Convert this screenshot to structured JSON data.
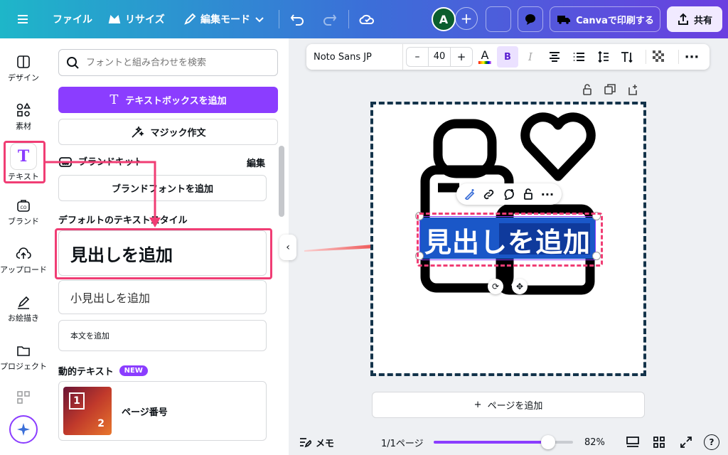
{
  "topbar": {
    "menu_icon": "hamburger-icon",
    "file_label": "ファイル",
    "resize_label": "リサイズ",
    "edit_mode_label": "編集モード",
    "avatar_initial": "A",
    "print_label": "Canvaで印刷する",
    "share_label": "共有"
  },
  "rail": [
    {
      "label": "デザイン",
      "icon": "layout-icon"
    },
    {
      "label": "素材",
      "icon": "shapes-icon"
    },
    {
      "label": "テキスト",
      "icon": "text-icon"
    },
    {
      "label": "ブランド",
      "icon": "brand-icon"
    },
    {
      "label": "アップロード",
      "icon": "upload-icon"
    },
    {
      "label": "お絵描き",
      "icon": "draw-icon"
    },
    {
      "label": "プロジェクト",
      "icon": "folder-icon"
    }
  ],
  "panel": {
    "search_placeholder": "フォントと組み合わせを検索",
    "add_textbox": "テキストボックスを追加",
    "magic_write": "マジック作文",
    "brand_kit": "ブランドキット",
    "edit": "編集",
    "add_brand_font": "ブランドフォントを追加",
    "default_styles": "デフォルトのテキストスタイル",
    "add_heading": "見出しを追加",
    "add_subheading": "小見出しを追加",
    "add_body": "本文を追加",
    "dynamic_text": "動的テキスト",
    "new_badge": "NEW",
    "page_number": "ページ番号",
    "thumb_numbers": [
      "1",
      "2"
    ]
  },
  "text_toolbar": {
    "font": "Noto Sans JP",
    "size": "40",
    "minus": "–",
    "plus": "+",
    "bold": "B",
    "italic": "I"
  },
  "canvas": {
    "heading_text": "見出しを追加",
    "add_page": "ページを追加"
  },
  "bottom": {
    "notes": "メモ",
    "page_indicator": "1/1ページ",
    "zoom": "82%",
    "zoom_fraction": 0.82,
    "help": "?"
  },
  "colors": {
    "accent": "#8b3dff",
    "highlight": "#f03d74",
    "selection": "#1a57c8"
  }
}
